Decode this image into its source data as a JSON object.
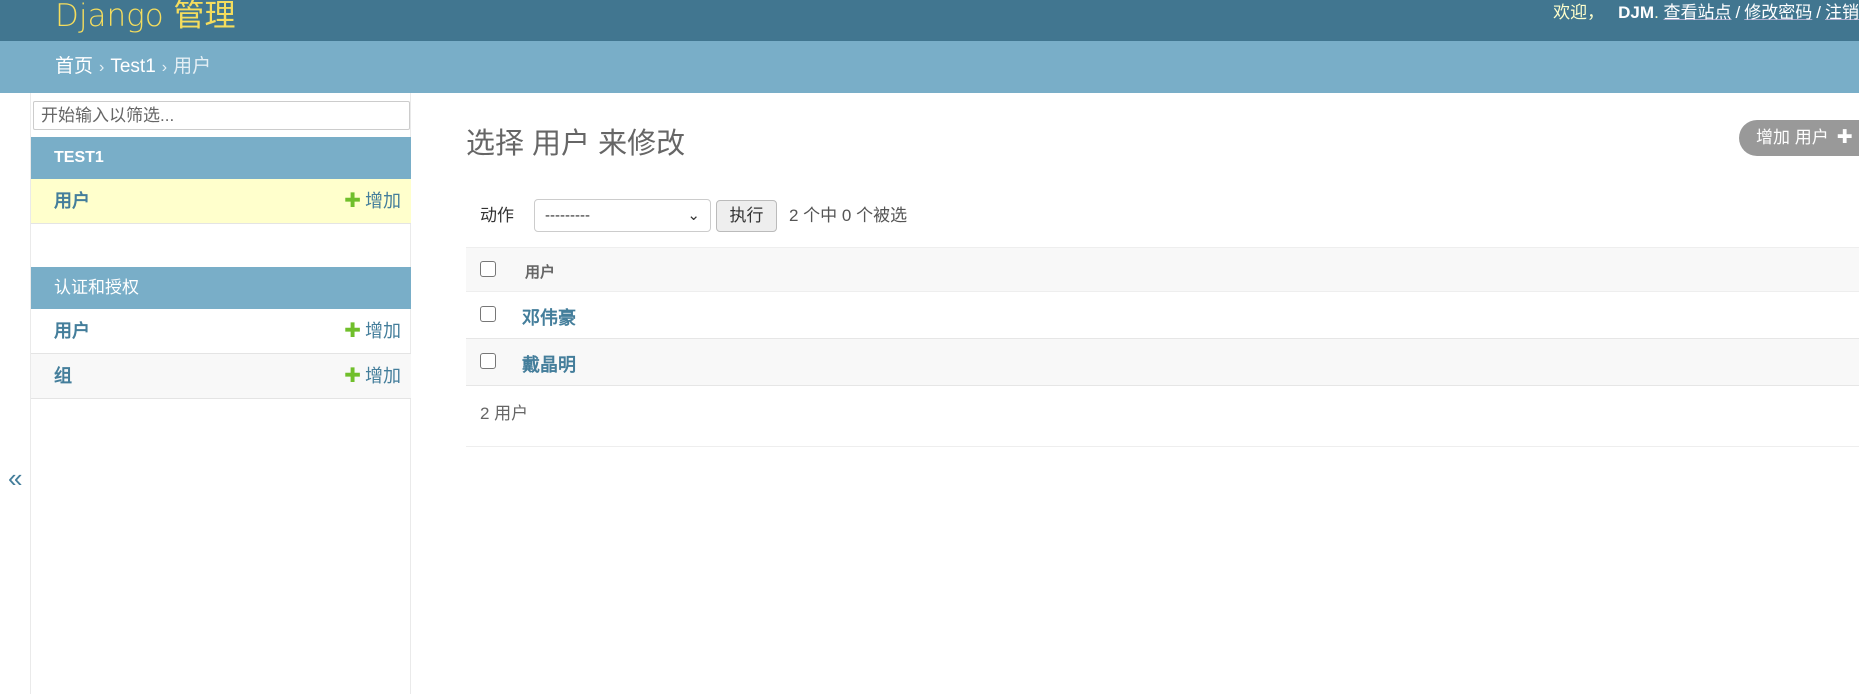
{
  "header": {
    "brand": "Django 管理",
    "welcome": "欢迎，",
    "username": "DJM",
    "after_name": ".",
    "view_site": "查看站点",
    "separator": "/",
    "change_password": "修改密码",
    "logout": "注销"
  },
  "breadcrumbs": {
    "home": "首页",
    "arrow": "›",
    "app": "Test1",
    "current": "用户"
  },
  "sidebar": {
    "toggle": "«",
    "filter_placeholder": "开始输入以筛选...",
    "apps": [
      {
        "caption": "TEST1",
        "models": [
          {
            "name": "用户",
            "add": "增加"
          }
        ]
      },
      {
        "caption": "认证和授权",
        "models": [
          {
            "name": "用户",
            "add": "增加"
          },
          {
            "name": "组",
            "add": "增加"
          }
        ]
      }
    ],
    "plus": "✚"
  },
  "content": {
    "title": "选择 用户 来修改",
    "add_button": "增加 用户",
    "add_plus": "✚",
    "actions_label": "动作",
    "action_selected": "---------",
    "go_button": "执行",
    "selection_count": "2 个中 0 个被选",
    "table": {
      "column": "用户",
      "rows": [
        "邓伟豪",
        "戴晶明"
      ]
    },
    "paginator": "2 用户"
  },
  "colors": {
    "header_bg": "#417690",
    "breadcrumb_bg": "#79aec8",
    "brand": "#f5dd5d",
    "link": "#447e9b",
    "add_green": "#70bf2b",
    "selected_row": "#ffffcc"
  }
}
